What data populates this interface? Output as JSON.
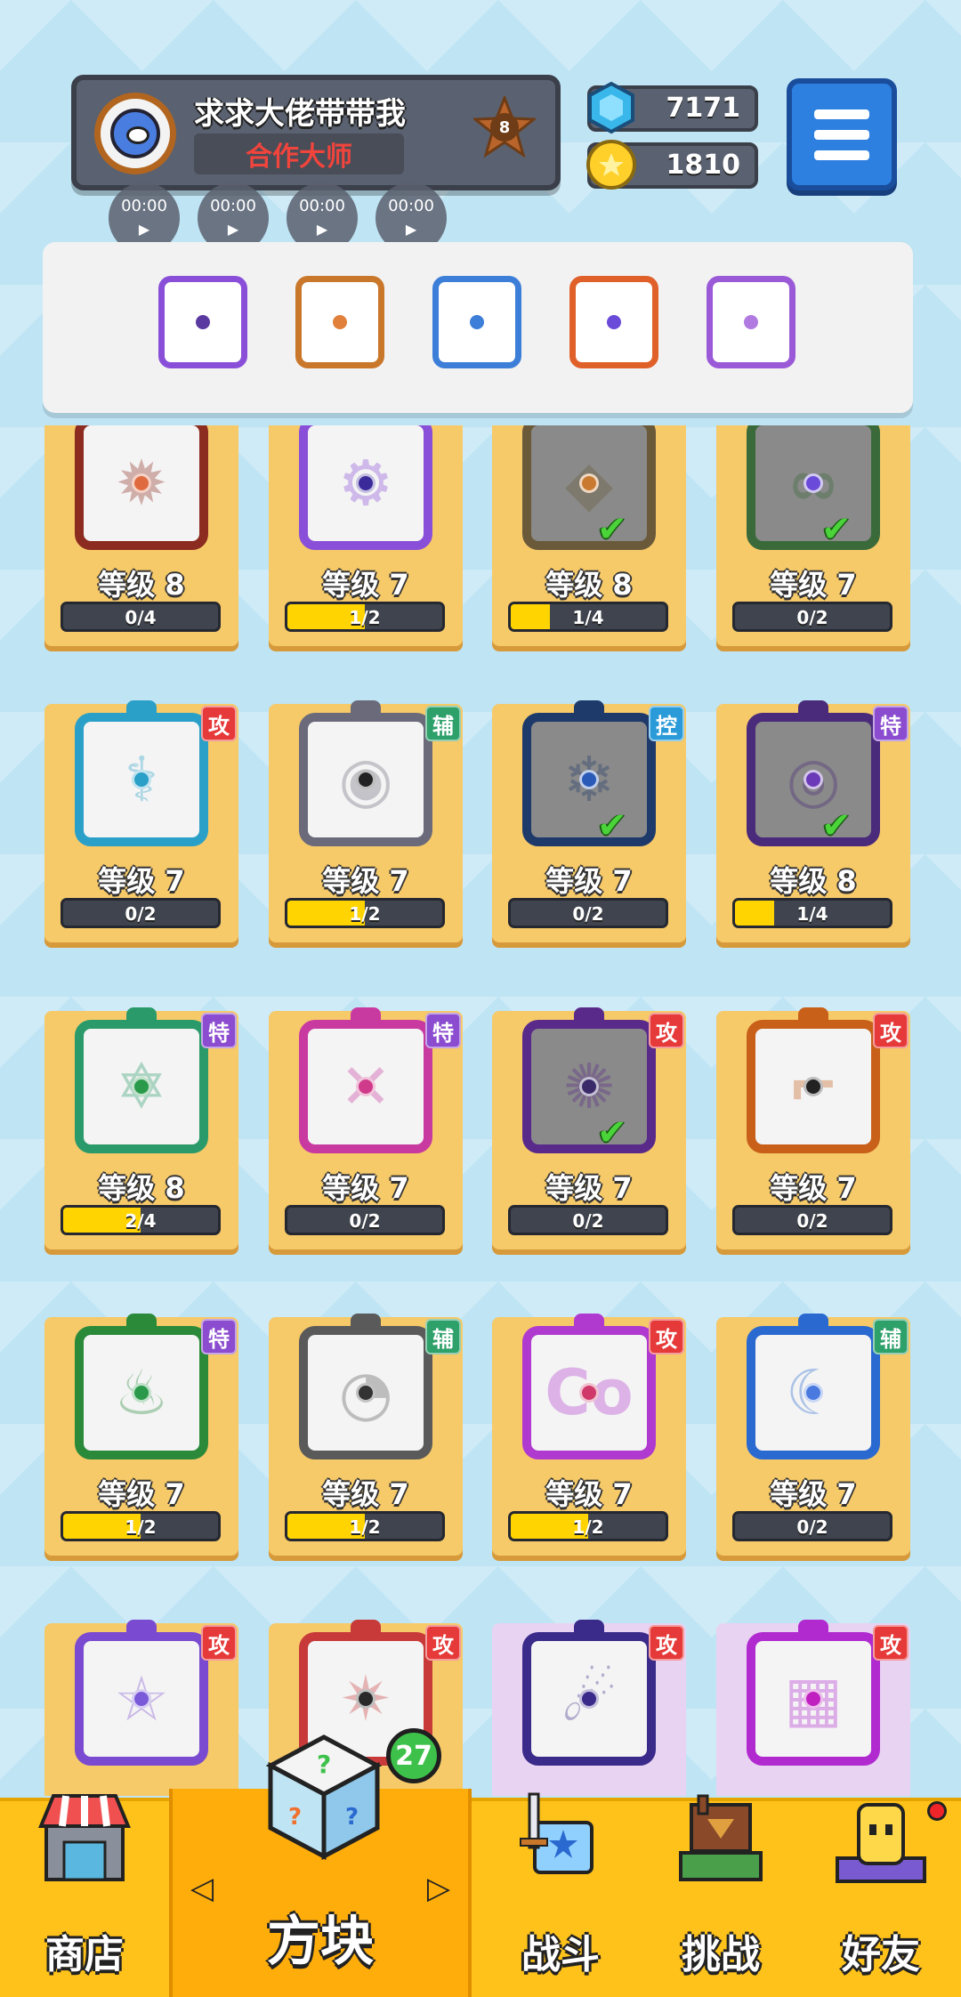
{
  "player": {
    "name": "求求大佬带带我",
    "title": "合作大师",
    "rank_level": "8",
    "avatar_icon": "mask-avatar-icon"
  },
  "audio_clips": [
    {
      "time": "00:00"
    },
    {
      "time": "00:00"
    },
    {
      "time": "00:00"
    },
    {
      "time": "00:00"
    }
  ],
  "currency": {
    "gems": "7171",
    "coins": "1810"
  },
  "colors": {
    "attack_tag": "#e63a3a",
    "support_tag": "#2ea06a",
    "control_tag": "#2a9bd8",
    "special_tag": "#8b4ccf",
    "card_bg": "#f6c969",
    "progress_fill": "#ffd400"
  },
  "equipped": [
    {
      "icon": "purple-orbit-dice-icon",
      "frame": "#8a4fd8",
      "dot": "#5a3aa0"
    },
    {
      "icon": "orange-dice-icon",
      "frame": "#c9772a",
      "dot": "#e0803a"
    },
    {
      "icon": "blue-snowflake-dice-icon",
      "frame": "#3c7ed8",
      "dot": "#3c7ed8"
    },
    {
      "icon": "rainbow-infinity-dice-icon",
      "frame": "#e0602a",
      "dot": "#6a4ad8"
    },
    {
      "icon": "purple-spiral-dice-icon",
      "frame": "#9a5ad8",
      "dot": "#b07ae0"
    }
  ],
  "cards": [
    {
      "level": "等级 8",
      "progress": "0/4",
      "fill": 0,
      "frame": "#8c2b1f",
      "dot": "#e06a40",
      "glyph": "✹",
      "tag": "",
      "tag_color": "",
      "check": false,
      "grey": false
    },
    {
      "level": "等级 7",
      "progress": "1/2",
      "fill": 0.5,
      "frame": "#8a4fd8",
      "dot": "#3a2a9a",
      "glyph": "⚙",
      "tag": "",
      "tag_color": "",
      "check": false,
      "grey": false
    },
    {
      "level": "等级 8",
      "progress": "1/4",
      "fill": 0.25,
      "frame": "#6a5a3a",
      "dot": "#c97a30",
      "glyph": "◆",
      "tag": "",
      "tag_color": "",
      "check": true,
      "grey": true
    },
    {
      "level": "等级 7",
      "progress": "0/2",
      "fill": 0,
      "frame": "#3a6a3a",
      "dot": "#6a4ad8",
      "glyph": "∞",
      "tag": "",
      "tag_color": "",
      "check": true,
      "grey": true
    },
    {
      "level": "等级 7",
      "progress": "0/2",
      "fill": 0,
      "frame": "#2aa0c8",
      "dot": "#2aa0c8",
      "glyph": "⚕",
      "tag": "攻",
      "tag_color": "#e63a3a",
      "check": false,
      "grey": false
    },
    {
      "level": "等级 7",
      "progress": "1/2",
      "fill": 0.5,
      "frame": "#6a6a7a",
      "dot": "#222222",
      "glyph": "◉",
      "tag": "辅",
      "tag_color": "#2ea06a",
      "check": false,
      "grey": false
    },
    {
      "level": "等级 7",
      "progress": "0/2",
      "fill": 0,
      "frame": "#1e3a6a",
      "dot": "#2a5ab8",
      "glyph": "❄",
      "tag": "控",
      "tag_color": "#2a9bd8",
      "check": true,
      "grey": true
    },
    {
      "level": "等级 8",
      "progress": "1/4",
      "fill": 0.25,
      "frame": "#4a2a7a",
      "dot": "#6a3ab8",
      "glyph": "◎",
      "tag": "特",
      "tag_color": "#8b4ccf",
      "check": true,
      "grey": true
    },
    {
      "level": "等级 8",
      "progress": "2/4",
      "fill": 0.5,
      "frame": "#2a9a6a",
      "dot": "#2a9a4a",
      "glyph": "✡",
      "tag": "特",
      "tag_color": "#8b4ccf",
      "check": false,
      "grey": false
    },
    {
      "level": "等级 7",
      "progress": "0/2",
      "fill": 0,
      "frame": "#c83aa0",
      "dot": "#d03a8a",
      "glyph": "✕",
      "tag": "特",
      "tag_color": "#8b4ccf",
      "check": false,
      "grey": false
    },
    {
      "level": "等级 7",
      "progress": "0/2",
      "fill": 0,
      "frame": "#5a2a8a",
      "dot": "#3a2a6a",
      "glyph": "✺",
      "tag": "攻",
      "tag_color": "#e63a3a",
      "check": true,
      "grey": true
    },
    {
      "level": "等级 7",
      "progress": "0/2",
      "fill": 0,
      "frame": "#c8601a",
      "dot": "#222222",
      "glyph": "⌐",
      "tag": "攻",
      "tag_color": "#e63a3a",
      "check": false,
      "grey": false
    },
    {
      "level": "等级 7",
      "progress": "1/2",
      "fill": 0.5,
      "frame": "#2a8a3a",
      "dot": "#2a9a4a",
      "glyph": "♨",
      "tag": "特",
      "tag_color": "#8b4ccf",
      "check": false,
      "grey": false
    },
    {
      "level": "等级 7",
      "progress": "1/2",
      "fill": 0.5,
      "frame": "#5a5a5a",
      "dot": "#333333",
      "glyph": "◔",
      "tag": "辅",
      "tag_color": "#2ea06a",
      "check": false,
      "grey": false
    },
    {
      "level": "等级 7",
      "progress": "1/2",
      "fill": 0.5,
      "frame": "#b03ad0",
      "dot": "#d03a6a",
      "glyph": "Co",
      "tag": "攻",
      "tag_color": "#e63a3a",
      "check": false,
      "grey": false
    },
    {
      "level": "等级 7",
      "progress": "0/2",
      "fill": 0,
      "frame": "#2a6ad0",
      "dot": "#4a7ae0",
      "glyph": "☾",
      "tag": "辅",
      "tag_color": "#2ea06a",
      "check": false,
      "grey": false
    },
    {
      "level": "",
      "progress": "",
      "fill": 0,
      "frame": "#7a4ad0",
      "dot": "#7a5ad8",
      "glyph": "☆",
      "tag": "攻",
      "tag_color": "#e63a3a",
      "check": false,
      "grey": false
    },
    {
      "level": "",
      "progress": "",
      "fill": 0,
      "frame": "#c83a3a",
      "dot": "#2a2a2a",
      "glyph": "✷",
      "tag": "攻",
      "tag_color": "#e63a3a",
      "check": false,
      "grey": false
    },
    {
      "level": "",
      "progress": "",
      "fill": 0,
      "frame": "#3a2a8a",
      "dot": "#3a2a8a",
      "glyph": "☄",
      "tag": "攻",
      "tag_color": "#e63a3a",
      "check": false,
      "grey": false,
      "locked": true
    },
    {
      "level": "",
      "progress": "",
      "fill": 0,
      "frame": "#b02ad0",
      "dot": "#c020c0",
      "glyph": "▦",
      "tag": "攻",
      "tag_color": "#e63a3a",
      "check": false,
      "grey": false,
      "locked": true
    }
  ],
  "nav": {
    "shop": "商店",
    "dice": "方块",
    "dice_badge": "27",
    "battle": "战斗",
    "challenge": "挑战",
    "friends": "好友",
    "prev_arrow": "◁",
    "next_arrow": "▷"
  }
}
